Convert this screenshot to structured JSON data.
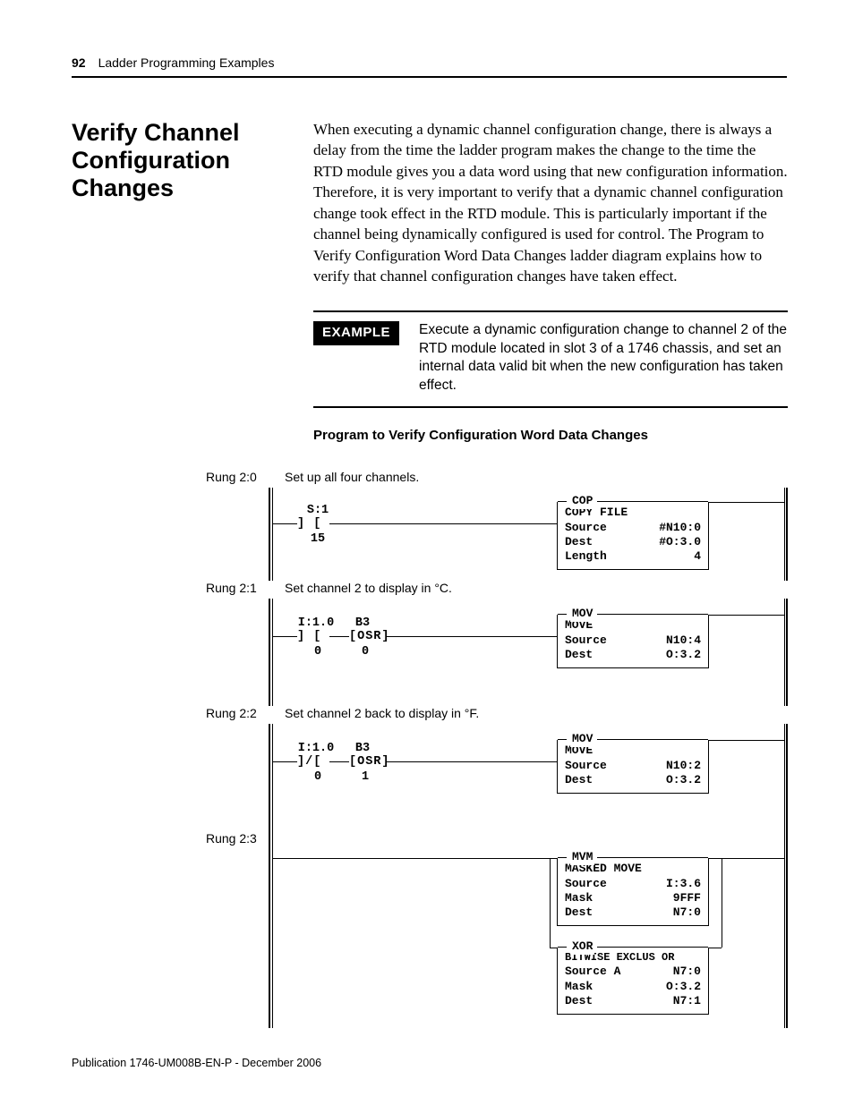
{
  "header": {
    "page_number": "92",
    "section": "Ladder Programming Examples"
  },
  "heading": "Verify Channel Configuration Changes",
  "paragraph": "When executing a dynamic channel configuration change, there is always a delay from the time the ladder program makes the change to the time the RTD module gives you a data word using that new configuration information. Therefore, it is very important to verify that a dynamic channel configuration change took effect in the RTD module. This is particularly important if the channel being dynamically configured is used for control. The Program to Verify Configuration Word Data Changes ladder diagram explains how to verify that channel configuration changes have taken effect.",
  "example": {
    "tag": "EXAMPLE",
    "text": "Execute a dynamic configuration change to channel 2 of the RTD module located in slot 3 of a 1746 chassis, and set an internal data valid bit when the new configuration has taken effect."
  },
  "diagram_title": "Program to Verify Configuration Word Data Changes",
  "rungs": {
    "r0": {
      "label": "Rung 2:0",
      "caption": "Set up all four channels.",
      "contact": {
        "addr": "S:1",
        "bit": "15"
      },
      "instr": {
        "mnemo": "COP",
        "title": "COPY FILE",
        "rows": [
          [
            "Source",
            "#N10:0"
          ],
          [
            "Dest",
            "#O:3.0"
          ],
          [
            "Length",
            "4"
          ]
        ]
      }
    },
    "r1": {
      "label": "Rung 2:1",
      "caption": "Set channel 2 to display in °C.",
      "c1": {
        "addr": "I:1.0",
        "bit": "0"
      },
      "c2": {
        "addr": "B3",
        "bit": "0",
        "tag": "[OSR]"
      },
      "instr": {
        "mnemo": "MOV",
        "title": "MOVE",
        "rows": [
          [
            "Source",
            "N10:4"
          ],
          [
            "",
            ""
          ],
          [
            "Dest",
            "O:3.2"
          ]
        ]
      }
    },
    "r2": {
      "label": "Rung 2:2",
      "caption": "Set channel 2 back to display in °F.",
      "c1": {
        "addr": "I:1.0",
        "bit": "0"
      },
      "c2": {
        "addr": "B3",
        "bit": "1",
        "tag": "[OSR]"
      },
      "instr": {
        "mnemo": "MOV",
        "title": "MOVE",
        "rows": [
          [
            "Source",
            "N10:2"
          ],
          [
            "",
            ""
          ],
          [
            "Dest",
            "O:3.2"
          ]
        ]
      }
    },
    "r3": {
      "label": "Rung 2:3",
      "instr1": {
        "mnemo": "MVM",
        "title": "MASKED MOVE",
        "rows": [
          [
            "Source",
            "I:3.6"
          ],
          [
            "Mask",
            "9FFF"
          ],
          [
            "Dest",
            "N7:0"
          ]
        ]
      },
      "instr2": {
        "mnemo": "XOR",
        "title": "BITWISE EXCLUS OR",
        "rows": [
          [
            "Source A",
            "N7:0"
          ],
          [
            "Mask",
            "O:3.2"
          ],
          [
            "Dest",
            "N7:1"
          ]
        ]
      }
    }
  },
  "footer": "Publication 1746-UM008B-EN-P - December 2006"
}
